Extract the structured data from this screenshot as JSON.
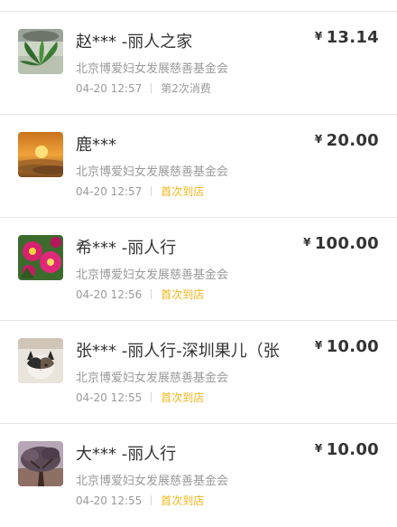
{
  "records": [
    {
      "name": "赵*** -丽人之家",
      "amount": "13.14",
      "org": "北京博爱妇女发展慈善基金会",
      "time": "04-20 12:57",
      "tag": "第2次消费",
      "tag_type": "repeat",
      "avatar": "plant-photo"
    },
    {
      "name": "鹿***",
      "amount": "20.00",
      "org": "北京博爱妇女发展慈善基金会",
      "time": "04-20 12:57",
      "tag": "首次到店",
      "tag_type": "new",
      "avatar": "sunrise-photo"
    },
    {
      "name": "希*** -丽人行",
      "amount": "100.00",
      "org": "北京博爱妇女发展慈善基金会",
      "time": "04-20 12:56",
      "tag": "首次到店",
      "tag_type": "new",
      "avatar": "flower-photo"
    },
    {
      "name": "张*** -丽人行-深圳果儿（张",
      "amount": "10.00",
      "org": "北京博爱妇女发展慈善基金会",
      "time": "04-20 12:55",
      "tag": "首次到店",
      "tag_type": "new",
      "avatar": "cat-photo"
    },
    {
      "name": "大*** -丽人行",
      "amount": "10.00",
      "org": "北京博爱妇女发展慈善基金会",
      "time": "04-20 12:55",
      "tag": "首次到店",
      "tag_type": "new",
      "avatar": "tree-photo"
    }
  ],
  "currency_symbol": "¥",
  "colors": {
    "accent_tag": "#f0b416",
    "muted": "#9a9a9a",
    "divider": "#e6e6e6"
  }
}
